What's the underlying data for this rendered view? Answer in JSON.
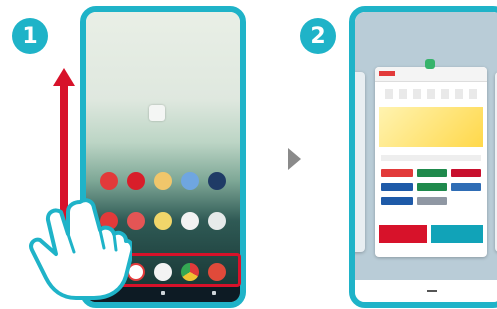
{
  "steps": [
    {
      "number": "1",
      "action": "swipe-up-from-bottom"
    },
    {
      "number": "2",
      "action": "recent-apps-view"
    }
  ],
  "colors": {
    "accent": "#1fb3c8",
    "highlight": "#d7122a",
    "arrow_next": "#8a8a8a"
  },
  "step1": {
    "app_rows": [
      [
        "red-app-icon",
        "red-app-icon",
        "orange-app-icon",
        "blue-app-icon",
        "dark-app-icon"
      ],
      [
        "red-app-icon",
        "red-app-icon",
        "yellow-app-icon",
        "white-app-icon",
        "white-app-icon"
      ]
    ],
    "dock_icons": [
      "phone-app-icon",
      "gmail-icon",
      "apps-grid-icon",
      "chrome-icon",
      "camera-app-icon"
    ],
    "nav_buttons": [
      "back-icon",
      "home-icon",
      "recents-icon"
    ]
  },
  "step2": {
    "view": "recent-apps",
    "card_count": 2
  }
}
